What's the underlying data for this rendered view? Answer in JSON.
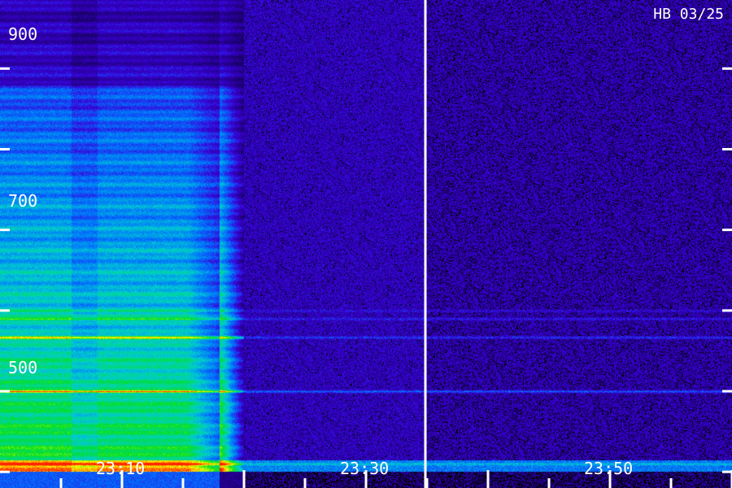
{
  "chart_data": {
    "type": "heatmap",
    "title": "HB 03/25",
    "xlabel": "",
    "ylabel": "",
    "x_tick_labels": [
      "23:10",
      "23:30",
      "23:50"
    ],
    "y_tick_labels": [
      "900",
      "700",
      "500"
    ],
    "y_major_ticks": [
      400,
      500,
      600,
      700,
      800,
      900
    ],
    "ylim": [
      380,
      985
    ],
    "grid": false,
    "colormap": [
      "#1a0068",
      "#3a00d8",
      "#0070ff",
      "#00d0d0",
      "#00e020",
      "#ffff00",
      "#ff2000"
    ],
    "background": "#000000",
    "sections": [
      {
        "name": "left-bright",
        "intensity": 0.75
      },
      {
        "name": "left-dark-strip",
        "intensity": 0.55
      },
      {
        "name": "mid-bright",
        "intensity": 0.8
      },
      {
        "name": "quiet-before-marker",
        "intensity": 0.12
      },
      {
        "name": "quiet-after-marker",
        "intensity": 0.1
      }
    ],
    "emission_lines": [
      {
        "y": 410,
        "strength": 0.55
      },
      {
        "y": 500,
        "strength": 0.9
      },
      {
        "y": 567,
        "strength": 0.65
      },
      {
        "y": 590,
        "strength": 0.45
      },
      {
        "y": 600,
        "strength": 0.3
      }
    ]
  }
}
